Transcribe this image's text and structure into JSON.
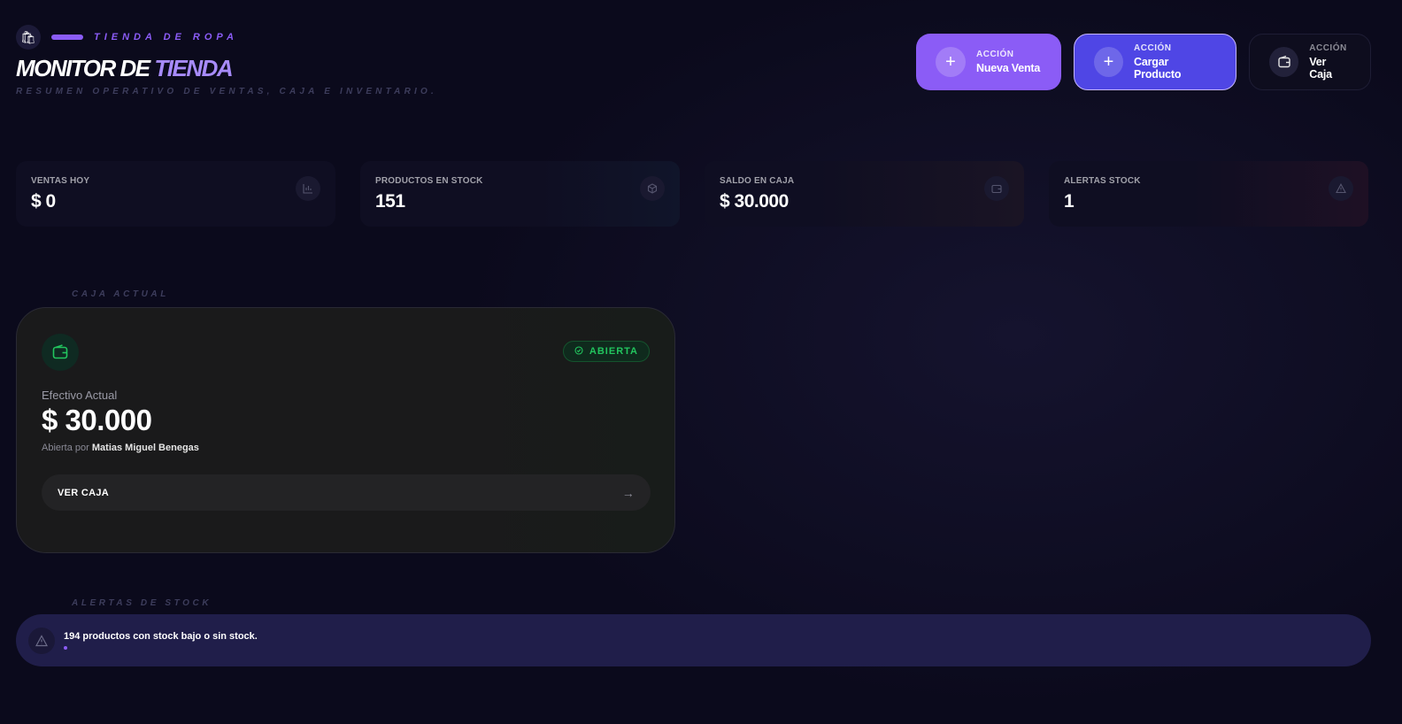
{
  "brand": {
    "logo_icon": "store-bag-icon",
    "tagline": "TIENDA DE ROPA",
    "title_main": "MONITOR DE",
    "title_accent": "TIENDA",
    "subtitle": "RESUMEN OPERATIVO DE VENTAS, CAJA E INVENTARIO."
  },
  "actions": [
    {
      "kicker": "ACCIÓN",
      "label": "Nueva Venta",
      "icon": "plus-icon"
    },
    {
      "kicker": "ACCIÓN",
      "label": "Cargar Producto",
      "icon": "plus-icon"
    },
    {
      "kicker": "ACCIÓN",
      "label": "Ver Caja",
      "icon": "wallet-icon"
    }
  ],
  "stats": [
    {
      "label": "VENTAS HOY",
      "value": "$ 0",
      "icon": "bar-chart-icon"
    },
    {
      "label": "PRODUCTOS EN STOCK",
      "value": "151",
      "icon": "box-icon"
    },
    {
      "label": "SALDO EN CAJA",
      "value": "$ 30.000",
      "icon": "wallet-icon"
    },
    {
      "label": "ALERTAS STOCK",
      "value": "1",
      "icon": "warning-icon"
    }
  ],
  "caja": {
    "section_label": "CAJA ACTUAL",
    "status": "ABIERTA",
    "sub_label": "Efectivo Actual",
    "amount": "$ 30.000",
    "opened_by_prefix": "Abierta por",
    "opened_by_name": "Matias Miguel Benegas",
    "button_label": "VER CAJA"
  },
  "alerts": {
    "section_label": "ALERTAS DE STOCK",
    "message": "194 productos con stock bajo o sin stock."
  },
  "colors": {
    "background": "#0b0a1c",
    "accent_purple": "#8b5cf6",
    "accent_indigo": "#4f46e5",
    "status_green": "#22c55e"
  }
}
